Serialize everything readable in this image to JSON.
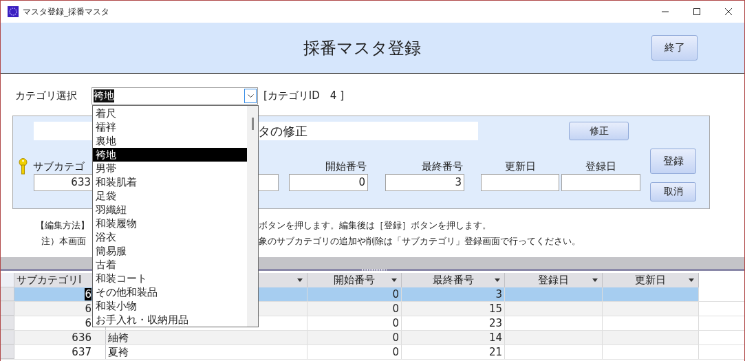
{
  "window": {
    "title": "マスタ登録_採番マスタ"
  },
  "header": {
    "title": "採番マスタ登録",
    "close_button": "終了"
  },
  "category": {
    "label": "カテゴリ選択",
    "value": "袴地",
    "id_label": "[カテゴリID　4 ]",
    "dropdown": {
      "expanded": true,
      "items": [
        {
          "label": "着尺",
          "selected": false
        },
        {
          "label": "襦袢",
          "selected": false
        },
        {
          "label": "裏地",
          "selected": false
        },
        {
          "label": "袴地",
          "selected": true
        },
        {
          "label": "男帯",
          "selected": false
        },
        {
          "label": "和装肌着",
          "selected": false
        },
        {
          "label": "足袋",
          "selected": false
        },
        {
          "label": "羽織紐",
          "selected": false
        },
        {
          "label": "和装履物",
          "selected": false
        },
        {
          "label": "浴衣",
          "selected": false
        },
        {
          "label": "簡易服",
          "selected": false
        },
        {
          "label": "古着",
          "selected": false
        },
        {
          "label": "和装コート",
          "selected": false
        },
        {
          "label": "その他和装品",
          "selected": false
        },
        {
          "label": "和装小物",
          "selected": false
        },
        {
          "label": "お手入れ・収納用品",
          "selected": false
        }
      ]
    }
  },
  "form": {
    "title": "タの修正",
    "edit_button": "修正",
    "fields": [
      {
        "kind": "key",
        "label": "サブカテゴ",
        "value": "633"
      },
      {
        "kind": "text"
      },
      {
        "kind": "number",
        "label": "開始番号",
        "value": "0"
      },
      {
        "kind": "number",
        "label": "最終番号",
        "value": "3"
      },
      {
        "kind": "date",
        "label": "更新日"
      },
      {
        "kind": "date",
        "label": "登録日"
      }
    ],
    "buttons": [
      "登録",
      "取消"
    ]
  },
  "notes": [
    {
      "parts": [
        "【編集方法】",
        "ボタンを押します。編集後は［登録］ボタンを押します。"
      ]
    },
    {
      "parts": [
        "注）本画面",
        "象のサブカテゴリの追加や削除は「サブカテゴリ」登録画面で行ってください。"
      ]
    }
  ],
  "table": {
    "columns": [
      {
        "label": "サブカテゴリI",
        "kind": "number"
      },
      {
        "kind": "text"
      },
      {
        "label": "開始番号",
        "kind": "number"
      },
      {
        "label": "最終番号",
        "kind": "number"
      },
      {
        "label": "登録日",
        "kind": "text"
      },
      {
        "label": "更新日",
        "kind": "text"
      }
    ],
    "rows": [
      {
        "selected": true,
        "id_highlighted": true,
        "cells": [
          "6",
          null,
          "0",
          "3",
          null,
          null
        ]
      },
      {
        "selected": false,
        "id_highlighted": false,
        "cells": [
          "6",
          null,
          "0",
          "15",
          null,
          null
        ]
      },
      {
        "selected": false,
        "id_highlighted": false,
        "cells": [
          "6",
          null,
          "0",
          "23",
          null,
          null
        ]
      },
      {
        "selected": false,
        "id_highlighted": false,
        "cells": [
          "636",
          "紬袴",
          "0",
          "14",
          null,
          null
        ]
      },
      {
        "selected": false,
        "id_highlighted": false,
        "cells": [
          "637",
          "夏袴",
          "0",
          "21",
          null,
          null
        ]
      }
    ]
  }
}
